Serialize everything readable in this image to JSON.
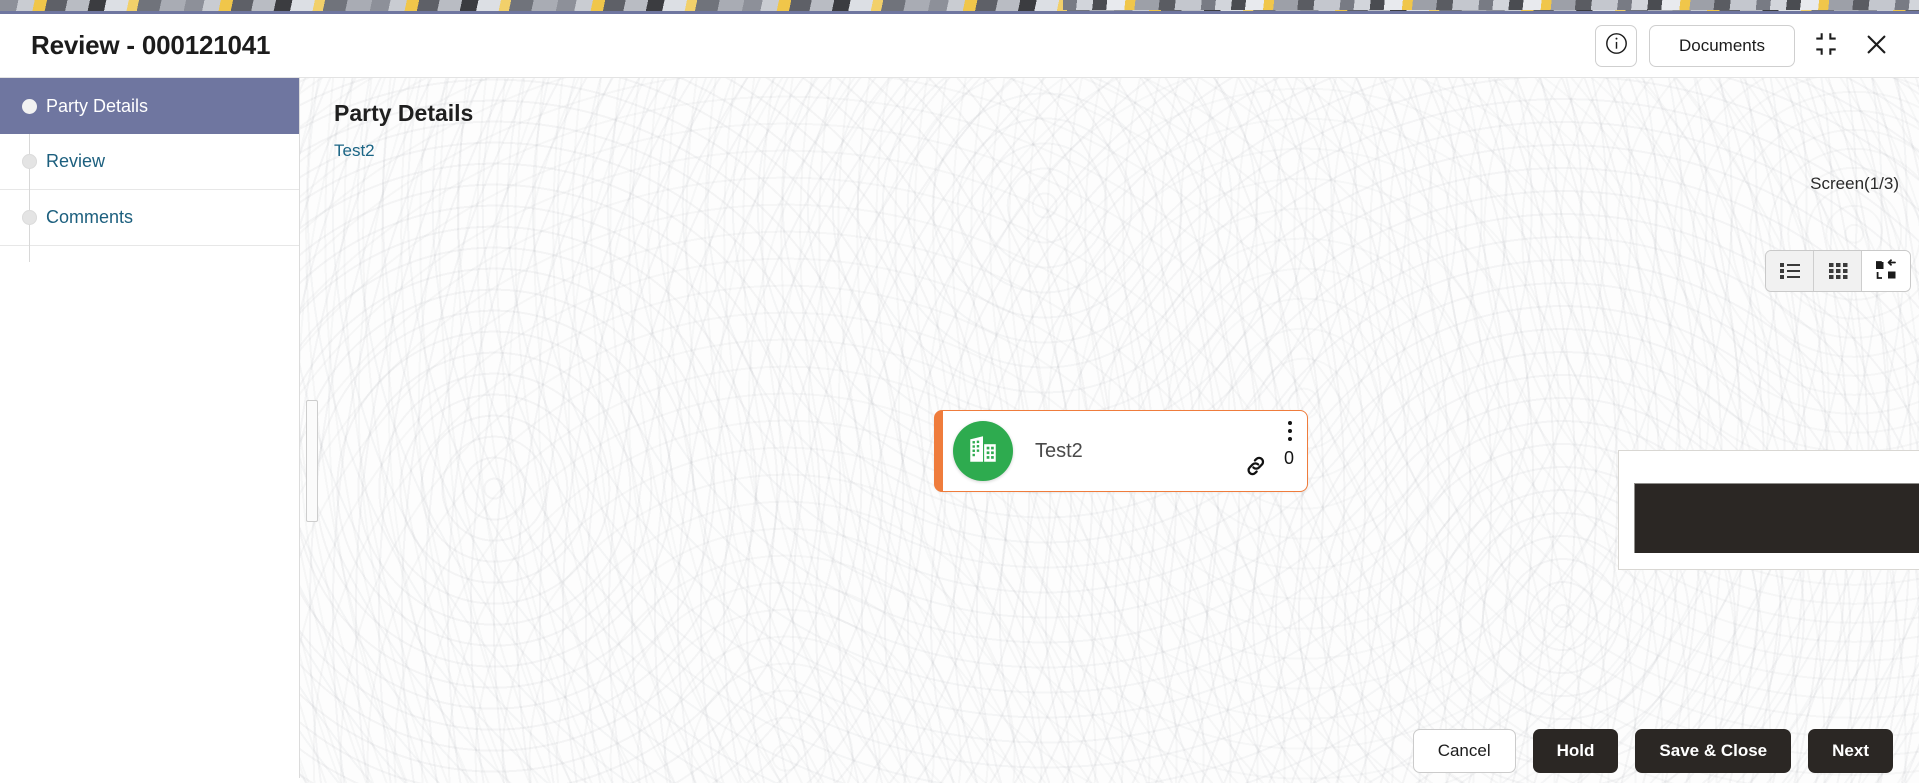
{
  "header": {
    "title": "Review - 000121041",
    "info_icon": "info-circle-icon",
    "documents_label": "Documents",
    "minimize_icon": "collapse-corners-icon",
    "close_icon": "close-x-icon"
  },
  "sidebar": {
    "items": [
      {
        "label": "Party Details",
        "active": true
      },
      {
        "label": "Review",
        "active": false
      },
      {
        "label": "Comments",
        "active": false
      }
    ]
  },
  "content": {
    "title": "Party Details",
    "breadcrumb": "Test2",
    "screen_counter": "Screen(1/3)",
    "view_toggle": [
      {
        "name": "list-view",
        "selected": false
      },
      {
        "name": "grid-view",
        "selected": false
      },
      {
        "name": "tree-view",
        "selected": true
      }
    ],
    "party_card": {
      "name": "Test2",
      "avatar_icon": "company-building-icon",
      "menu_icon": "kebab-menu-icon",
      "count": "0",
      "link_icon": "chain-link-icon",
      "accent_color": "#ef7c3c",
      "avatar_color": "#2eab4f"
    }
  },
  "footer": {
    "cancel_label": "Cancel",
    "hold_label": "Hold",
    "save_close_label": "Save & Close",
    "next_label": "Next"
  }
}
